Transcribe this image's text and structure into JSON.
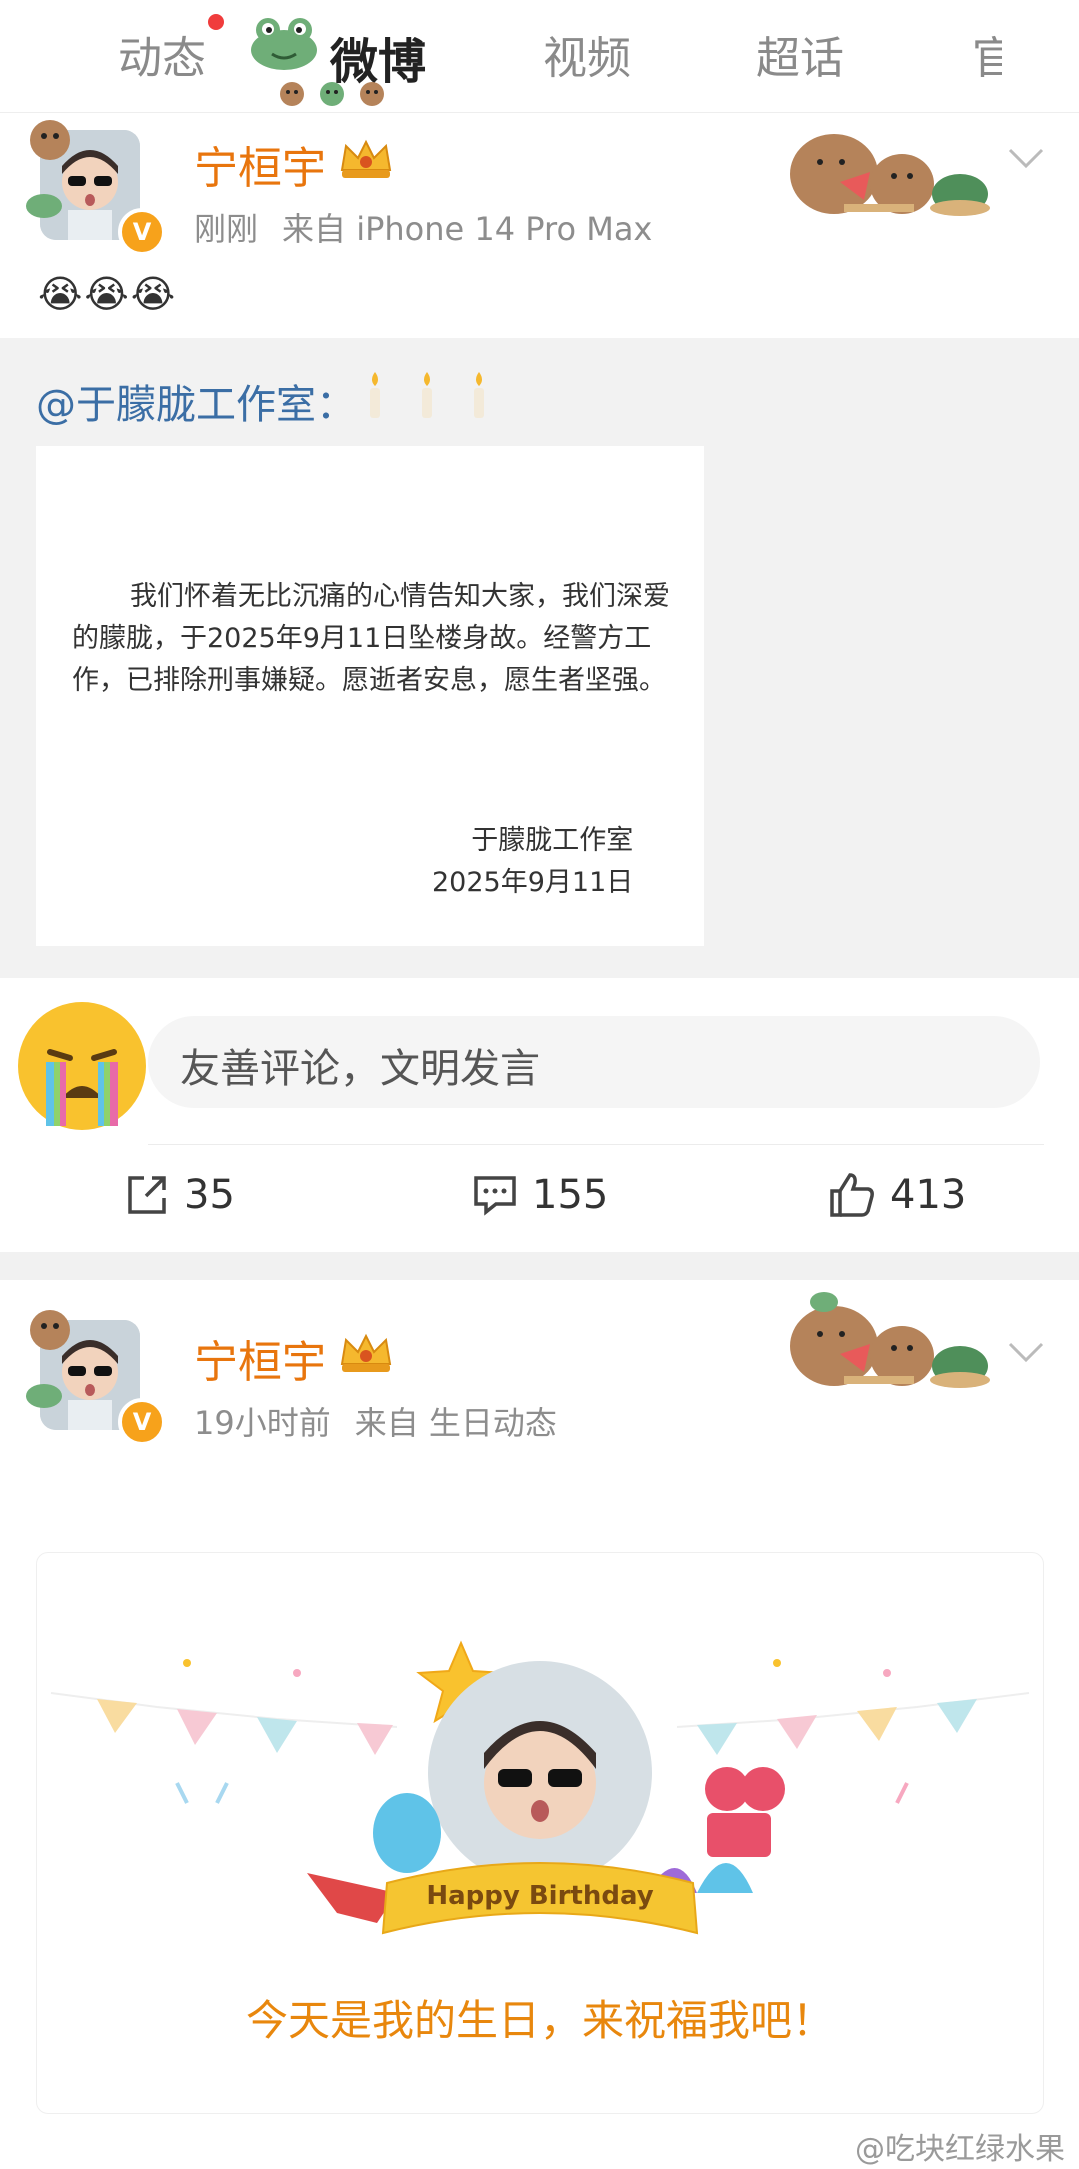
{
  "topbar": {
    "tabs": [
      "动态",
      "微博",
      "视频",
      "超话",
      "官"
    ],
    "active_tab": "微博"
  },
  "post1": {
    "username": "宁桓宇",
    "verified_badge": "V",
    "time": "刚刚",
    "source": "来自 iPhone 14 Pro Max",
    "emojis": "😭😭😭",
    "repost": {
      "text": "@于朦胧工作室：",
      "notice_body": "我们怀着无比沉痛的心情告知大家，我们深爱的朦胧，于2025年9月11日坠楼身故。经警方工作，已排除刑事嫌疑。愿逝者安息，愿生者坚强。",
      "notice_signature": "于朦胧工作室",
      "notice_date": "2025年9月11日"
    },
    "comment_placeholder": "友善评论，文明发言",
    "actions": {
      "reposts": "35",
      "comments": "155",
      "likes": "413"
    }
  },
  "post2": {
    "username": "宁桓宇",
    "verified_badge": "V",
    "time": "19小时前",
    "source": "来自 生日动态",
    "birthday_banner": "Happy Birthday",
    "birthday_text": "今天是我的生日，来祝福我吧！"
  },
  "watermark": "@吃块红绿水果",
  "colors": {
    "username": "#e8750d",
    "link": "#3b6ea5",
    "birthday_text": "#e8870d",
    "badge": "#f7a21b"
  }
}
